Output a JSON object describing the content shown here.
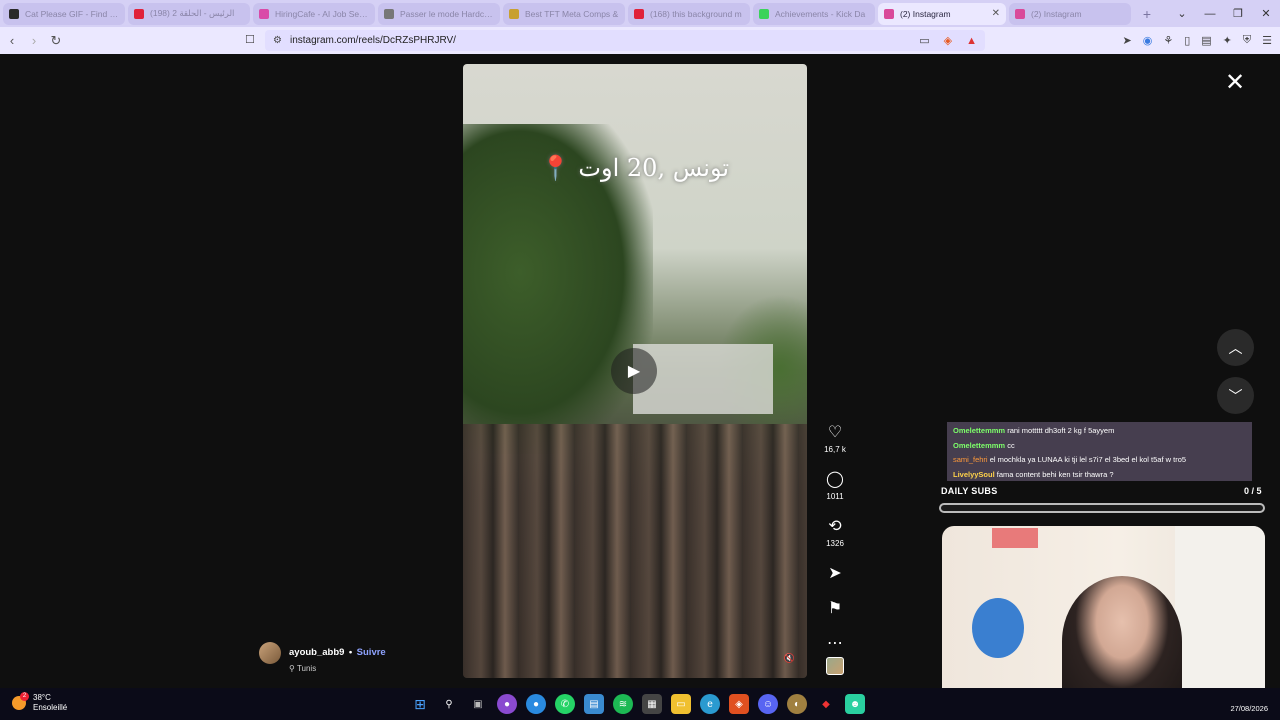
{
  "tabs": [
    {
      "title": "Cat Please GIF - Find & S",
      "color": "#2a2a2a",
      "active": false
    },
    {
      "title": "الرئيس - الحلقة 2 (198)",
      "color": "#e0223a",
      "active": false
    },
    {
      "title": "HiringCafe - AI Job Search",
      "color": "#d94aa8",
      "active": false
    },
    {
      "title": "Passer le mode Hardcore",
      "color": "#777777",
      "active": false
    },
    {
      "title": "Best TFT Meta Comps &",
      "color": "#c8a030",
      "active": false
    },
    {
      "title": "(168) this background m",
      "color": "#e0223a",
      "active": false
    },
    {
      "title": "Achievements - Kick Da",
      "color": "#3ad35a",
      "active": false
    },
    {
      "title": "(2) Instagram",
      "color": "#d94a9a",
      "active": true
    },
    {
      "title": "(2) Instagram",
      "color": "#d94a9a",
      "active": false
    }
  ],
  "address": {
    "url": "instagram.com/reels/DcRZsPHRJRV/"
  },
  "reel": {
    "overlay_text": "تونس ,20 اوت 📍",
    "likes": "16,7 k",
    "comments": "1011",
    "reposts": "1326",
    "author": "ayoub_abb9",
    "separator": "•",
    "follow": "Suivre",
    "location": "Tunis"
  },
  "icons": {
    "close": "✕",
    "play": "▶",
    "like": "♡",
    "comment": "◯",
    "repost": "⟲",
    "share": "➤",
    "save": "⚑",
    "more": "⋯",
    "up": "︿",
    "down": "﹀",
    "pin": "⚲",
    "mute": "🔇"
  },
  "stream": {
    "chat": [
      {
        "user": "Omelettemmm",
        "msg": "rani mottttt dh3oft 2 kg f 5ayyem"
      },
      {
        "user": "Omelettemmm",
        "msg": "cc"
      },
      {
        "user": "sami_fehri",
        "msg": "el mochkla ya LUNAA ki tji lel s7i7 el 3bed el kol t5af w tro5"
      },
      {
        "user": "LivelyySoul",
        "msg": "fama content behi ken tsir thawra ?"
      }
    ],
    "daily_subs_label": "DAILY SUBS",
    "daily_subs_count": "0 / 5",
    "daily_subs_progress": 0
  },
  "taskbar": {
    "temperature": "38°C",
    "condition": "Ensoleillé",
    "weather_badge": "2",
    "date": "27/08/2026"
  }
}
